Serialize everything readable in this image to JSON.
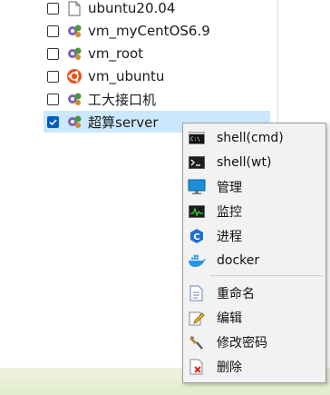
{
  "tree": {
    "items": [
      {
        "label": "ubuntu20.04",
        "checked": false,
        "icon": "document-icon"
      },
      {
        "label": "vm_myCentOS6.9",
        "checked": false,
        "icon": "server-gear-icon"
      },
      {
        "label": "vm_root",
        "checked": false,
        "icon": "server-gear-icon"
      },
      {
        "label": "vm_ubuntu",
        "checked": false,
        "icon": "ubuntu-icon"
      },
      {
        "label": "工大接口机",
        "checked": false,
        "icon": "server-gear-icon"
      },
      {
        "label": "超算server",
        "checked": true,
        "icon": "server-gear-icon"
      }
    ]
  },
  "context_menu": {
    "items": [
      {
        "label": "shell(cmd)",
        "icon": "cmd-icon"
      },
      {
        "label": "shell(wt)",
        "icon": "terminal-icon"
      },
      {
        "label": "管理",
        "icon": "monitor-icon"
      },
      {
        "label": "监控",
        "icon": "activity-monitor-icon"
      },
      {
        "label": "进程",
        "icon": "process-icon"
      },
      {
        "label": "docker",
        "icon": "docker-icon"
      },
      {
        "label": "重命名",
        "icon": "rename-icon"
      },
      {
        "label": "编辑",
        "icon": "edit-icon"
      },
      {
        "label": "修改密码",
        "icon": "key-icon"
      },
      {
        "label": "删除",
        "icon": "delete-icon"
      }
    ]
  },
  "colors": {
    "selection": "#cce8ff",
    "checkbox_checked": "#0060c0",
    "menu_bg": "#f2f2f2"
  }
}
